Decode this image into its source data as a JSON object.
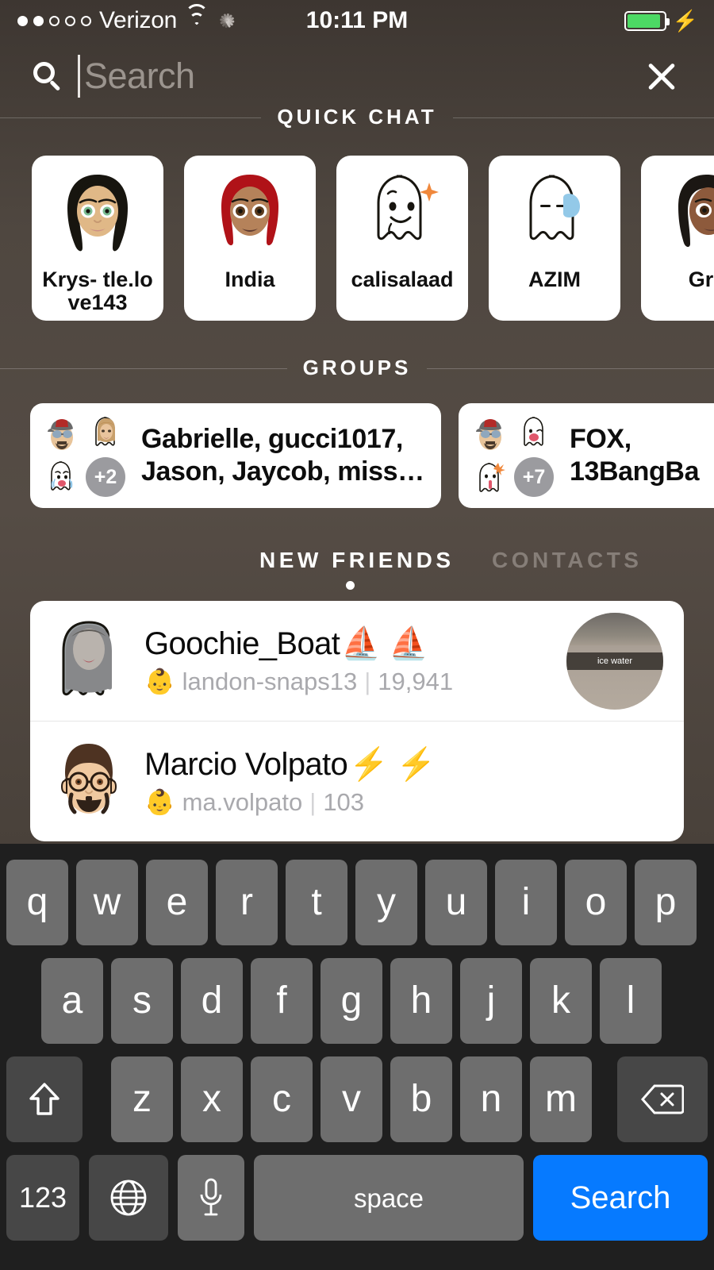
{
  "status_bar": {
    "signal_dots": [
      true,
      true,
      false,
      false,
      false
    ],
    "carrier": "Verizon",
    "wifi_icon": "wifi-icon",
    "activity_icon": "activity-spinner-icon",
    "time": "10:11 PM",
    "location_icon": "location-arrow-icon",
    "battery_level_pct": 92,
    "battery_color": "#4cd964",
    "charging_icon": "lightning-bolt-icon"
  },
  "search": {
    "icon": "search-icon",
    "placeholder": "Search",
    "value": "",
    "close_icon": "close-icon"
  },
  "sections": {
    "quick_chat_label": "QUICK CHAT",
    "groups_label": "GROUPS"
  },
  "quick_chat": {
    "cards": [
      {
        "name": "Krys-\ntle.love143",
        "avatar": "bitmoji-black-hair-female"
      },
      {
        "name": "India",
        "avatar": "bitmoji-red-hair-female"
      },
      {
        "name": "calisalaad",
        "avatar": "ghost-sparkle-icon"
      },
      {
        "name": "AZIM",
        "avatar": "ghost-sleeping-icon"
      },
      {
        "name": "Gra",
        "avatar": "bitmoji-dark-hair-female"
      }
    ]
  },
  "groups": {
    "cards": [
      {
        "names": "Gabrielle, gucci1017,\nJason, Jaycob, miss…",
        "overflow_badge": "+2",
        "avatars": [
          "bitmoji-cap-sunglasses",
          "ghost-photo-blonde",
          "ghost-crying-icon"
        ]
      },
      {
        "names": "FOX,\n13BangBa",
        "overflow_badge": "+7",
        "avatars": [
          "bitmoji-cap-sunglasses",
          "ghost-tongue-icon",
          "ghost-shocked-icon"
        ]
      }
    ]
  },
  "tabs": {
    "items": [
      {
        "label": "NEW FRIENDS",
        "active": true
      },
      {
        "label": "CONTACTS",
        "active": false
      }
    ]
  },
  "results": {
    "rows": [
      {
        "avatar": "ghost-photo-avatar",
        "title": "Goochie_Boat",
        "title_emoji": "⛵ ⛵",
        "sub_emoji": "👶",
        "username": "landon-snaps13",
        "separator": "|",
        "score": "19,941",
        "thumbnail_caption": "ice water",
        "has_thumbnail": true
      },
      {
        "avatar": "bitmoji-glasses-beard-male",
        "title": "Marcio Volpato",
        "title_emoji": "⚡ ⚡",
        "sub_emoji": "👶",
        "username": "ma.volpato",
        "separator": "|",
        "score": "103",
        "thumbnail_caption": "",
        "has_thumbnail": false
      }
    ]
  },
  "keyboard": {
    "row1": [
      "q",
      "w",
      "e",
      "r",
      "t",
      "y",
      "u",
      "i",
      "o",
      "p"
    ],
    "row2": [
      "a",
      "s",
      "d",
      "f",
      "g",
      "h",
      "j",
      "k",
      "l"
    ],
    "row3": [
      "z",
      "x",
      "c",
      "v",
      "b",
      "n",
      "m"
    ],
    "shift_icon": "shift-arrow-icon",
    "backspace_icon": "backspace-icon",
    "numbers_label": "123",
    "globe_icon": "globe-icon",
    "mic_icon": "microphone-icon",
    "space_label": "space",
    "return_label": "Search",
    "return_color": "#067aff"
  }
}
